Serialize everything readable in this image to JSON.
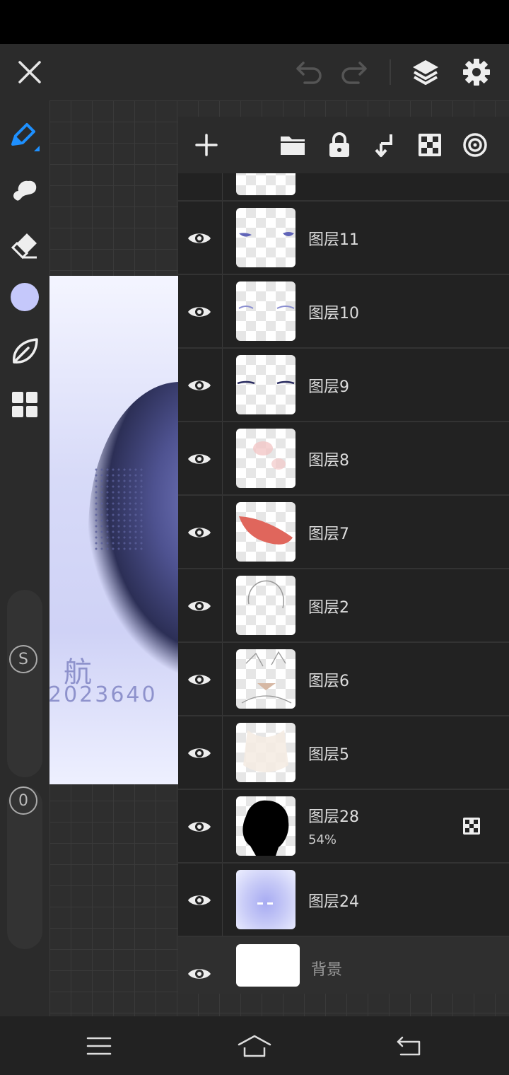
{
  "app": {
    "accent": "#1e90ff",
    "brush_color": "#c5c8fb",
    "top_icons": [
      "close-icon",
      "undo-icon",
      "redo-icon",
      "layers-icon",
      "settings-icon"
    ]
  },
  "artwork": {
    "text_1": "航",
    "text_2": "2023640"
  },
  "left_tools": {
    "icons": [
      "pen-icon",
      "smudge-icon",
      "eraser-icon",
      "color-swatch",
      "blend-icon",
      "grid-icon"
    ],
    "size_knob": "S",
    "opacity_knob": "0"
  },
  "layer_panel": {
    "toolbar_icons": [
      "add-icon",
      "folder-icon",
      "lock-icon",
      "merge-down-icon",
      "checker-icon",
      "target-icon"
    ],
    "layers": [
      {
        "name": "",
        "sub": ""
      },
      {
        "name": "图层11",
        "sub": ""
      },
      {
        "name": "图层10",
        "sub": ""
      },
      {
        "name": "图层9",
        "sub": ""
      },
      {
        "name": "图层8",
        "sub": ""
      },
      {
        "name": "图层7",
        "sub": ""
      },
      {
        "name": "图层2",
        "sub": ""
      },
      {
        "name": "图层6",
        "sub": ""
      },
      {
        "name": "图层5",
        "sub": ""
      },
      {
        "name": "图层28",
        "sub": "54%"
      },
      {
        "name": "图层24",
        "sub": ""
      },
      {
        "name": "背景",
        "sub": ""
      }
    ]
  },
  "nav": {
    "icons": [
      "menu-icon",
      "home-icon",
      "back-icon"
    ]
  }
}
